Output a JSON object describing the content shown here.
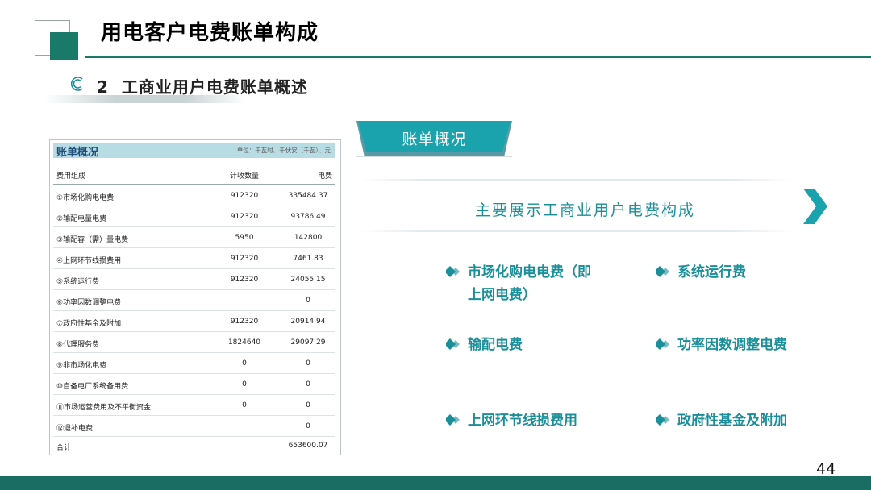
{
  "header": {
    "title": "用电客户电费账单构成"
  },
  "section": {
    "number": "2",
    "title": "工商业用户电费账单概述"
  },
  "bill": {
    "title": "账单概况",
    "unit": "单位：千瓦时、千伏安（千瓦）、元",
    "columns": [
      "费用组成",
      "计收数量",
      "电费"
    ],
    "rows": [
      [
        "①市场化购电电费",
        "912320",
        "335484.37"
      ],
      [
        "②输配电量电费",
        "912320",
        "93786.49"
      ],
      [
        "③输配容（需）量电费",
        "5950",
        "142800"
      ],
      [
        "④上网环节线损费用",
        "912320",
        "7461.83"
      ],
      [
        "⑤系统运行费",
        "912320",
        "24055.15"
      ],
      [
        "⑥功率因数调整电费",
        "",
        "0"
      ],
      [
        "⑦政府性基金及附加",
        "912320",
        "20914.94"
      ],
      [
        "⑧代理服务费",
        "1824640",
        "29097.29"
      ],
      [
        "⑨非市场化电费",
        "0",
        "0"
      ],
      [
        "⑩自备电厂系统备用费",
        "0",
        "0"
      ],
      [
        "⑪市场运营费用及不平衡资金",
        "0",
        "0"
      ],
      [
        "⑫退补电费",
        "",
        "0"
      ],
      [
        "合计",
        "",
        "653600.07"
      ]
    ]
  },
  "overview": {
    "tab_label": "账单概况",
    "main_text": "主要展示工商业用户电费构成",
    "items": {
      "a_line1": "市场化购电电费（即",
      "a_line2": "上网电费）",
      "b": "系统运行费",
      "c": "输配电费",
      "d": "功率因数调整电费",
      "e": "上网环节线损费用",
      "f": "政府性基金及附加"
    }
  },
  "footer": {
    "page_number": "44"
  },
  "colors": {
    "accent": "#1a8f9a",
    "brand_dark": "#1a7a6a",
    "footer": "#1a6d62"
  }
}
